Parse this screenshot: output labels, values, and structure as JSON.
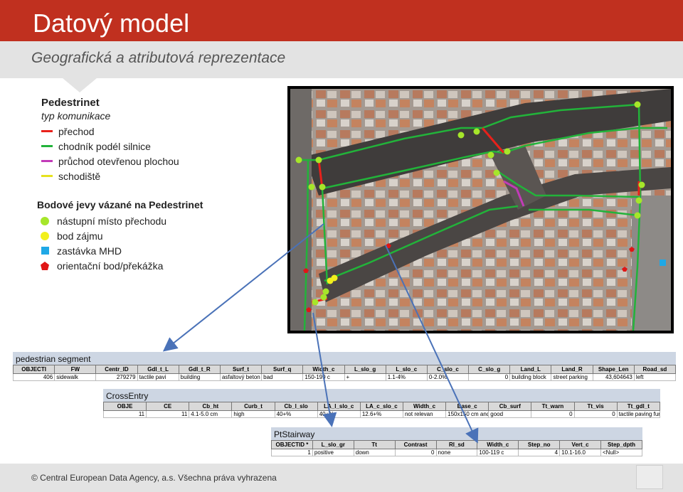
{
  "header": {
    "title": "Datový model",
    "subtitle": "Geografická a atributová reprezentace"
  },
  "legend": {
    "title": "Pedestrinet",
    "subtitle": "typ komunikace",
    "lines": [
      {
        "label": "přechod",
        "color": "#e8211b"
      },
      {
        "label": "chodník podél silnice",
        "color": "#22b33a"
      },
      {
        "label": "průchod otevřenou plochou",
        "color": "#c23bb8"
      },
      {
        "label": "schodiště",
        "color": "#e6e21e"
      }
    ],
    "points_title": "Bodové jevy vázané na Pedestrinet",
    "points": [
      {
        "label": "nástupní místo přechodu",
        "symbol": "dot",
        "color": "#a6e62a"
      },
      {
        "label": "bod zájmu",
        "symbol": "dot",
        "color": "#f2f01c"
      },
      {
        "label": "zastávka MHD",
        "symbol": "square",
        "color": "#1fa8e6"
      },
      {
        "label": "orientační bod/překážka",
        "symbol": "pentagon",
        "color": "#e01616"
      }
    ]
  },
  "tables": {
    "pedestrian": {
      "name": "pedestrian segment",
      "headers": [
        "OBJECTI",
        "FW",
        "Centr_ID",
        "Gdl_t_L",
        "Gdl_t_R",
        "Surf_t",
        "Surf_q",
        "Width_c",
        "L_slo_g",
        "L_slo_c",
        "C_slo_c",
        "C_slo_g",
        "Land_L",
        "Land_R",
        "Shape_Len",
        "Road_sd"
      ],
      "row": [
        "406",
        "sidewalk",
        "279279",
        "tactile pavi",
        "building",
        "asfaltový beton",
        "bad",
        "150-199 c",
        "+",
        "1.1-4%",
        "0-2.0%",
        "0",
        "building block",
        "street parking",
        "43,604643",
        "left"
      ]
    },
    "cross": {
      "name": "CrossEntry",
      "headers": [
        "OBJE",
        "CE",
        "Cb_ht",
        "Curb_t",
        "Cb_l_slo",
        "LA_l_slo_c",
        "LA_c_slo_c",
        "Width_c",
        "Base_c",
        "Cb_surf",
        "Tt_warn",
        "Tt_vis",
        "Tt_gdl_t"
      ],
      "row": [
        "11",
        "11",
        "4.1-5.0 cm",
        "high",
        "40+%",
        "40+%",
        "12.6+%",
        "not relevan",
        "150x150 cm and",
        "good",
        "0",
        "0",
        "tactile paving functional"
      ]
    },
    "stair": {
      "name": "PtStairway",
      "headers": [
        "OBJECTID *",
        "L_slo_gr",
        "Tt",
        "Contrast",
        "Rl_sd",
        "Width_c",
        "Step_no",
        "Vert_c",
        "Step_dpth"
      ],
      "row": [
        "1",
        "positive",
        "down",
        "0",
        "none",
        "100-119 c",
        "4",
        "10.1-16.0",
        "<Null>"
      ]
    }
  },
  "footer": {
    "copyright": "© Central European  Data Agency, a.s. Všechna práva vyhrazena"
  }
}
